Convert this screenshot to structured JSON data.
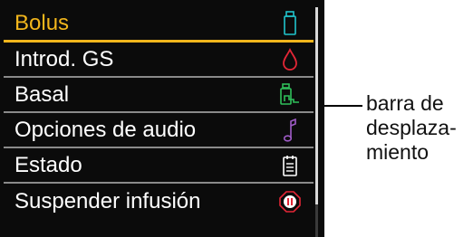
{
  "menu": {
    "items": [
      {
        "label": "Bolus",
        "icon": "insulin-vial-icon",
        "selected": true
      },
      {
        "label": "Introd. GS",
        "icon": "blood-drop-icon",
        "selected": false
      },
      {
        "label": "Basal",
        "icon": "basal-rate-icon",
        "selected": false
      },
      {
        "label": "Opciones de audio",
        "icon": "music-note-icon",
        "selected": false
      },
      {
        "label": "Estado",
        "icon": "clipboard-icon",
        "selected": false
      },
      {
        "label": "Suspender infusión",
        "icon": "stop-sign-icon",
        "selected": false
      }
    ]
  },
  "annotation": {
    "lines": [
      "barra de",
      "desplaza-",
      "miento"
    ]
  },
  "colors": {
    "selected": "#f2b61c",
    "vial": "#20c4cc",
    "drop": "#e32636",
    "basal": "#2fbf5a",
    "audio": "#a05cc8",
    "status": "#ffffff",
    "suspend": "#e32636"
  }
}
